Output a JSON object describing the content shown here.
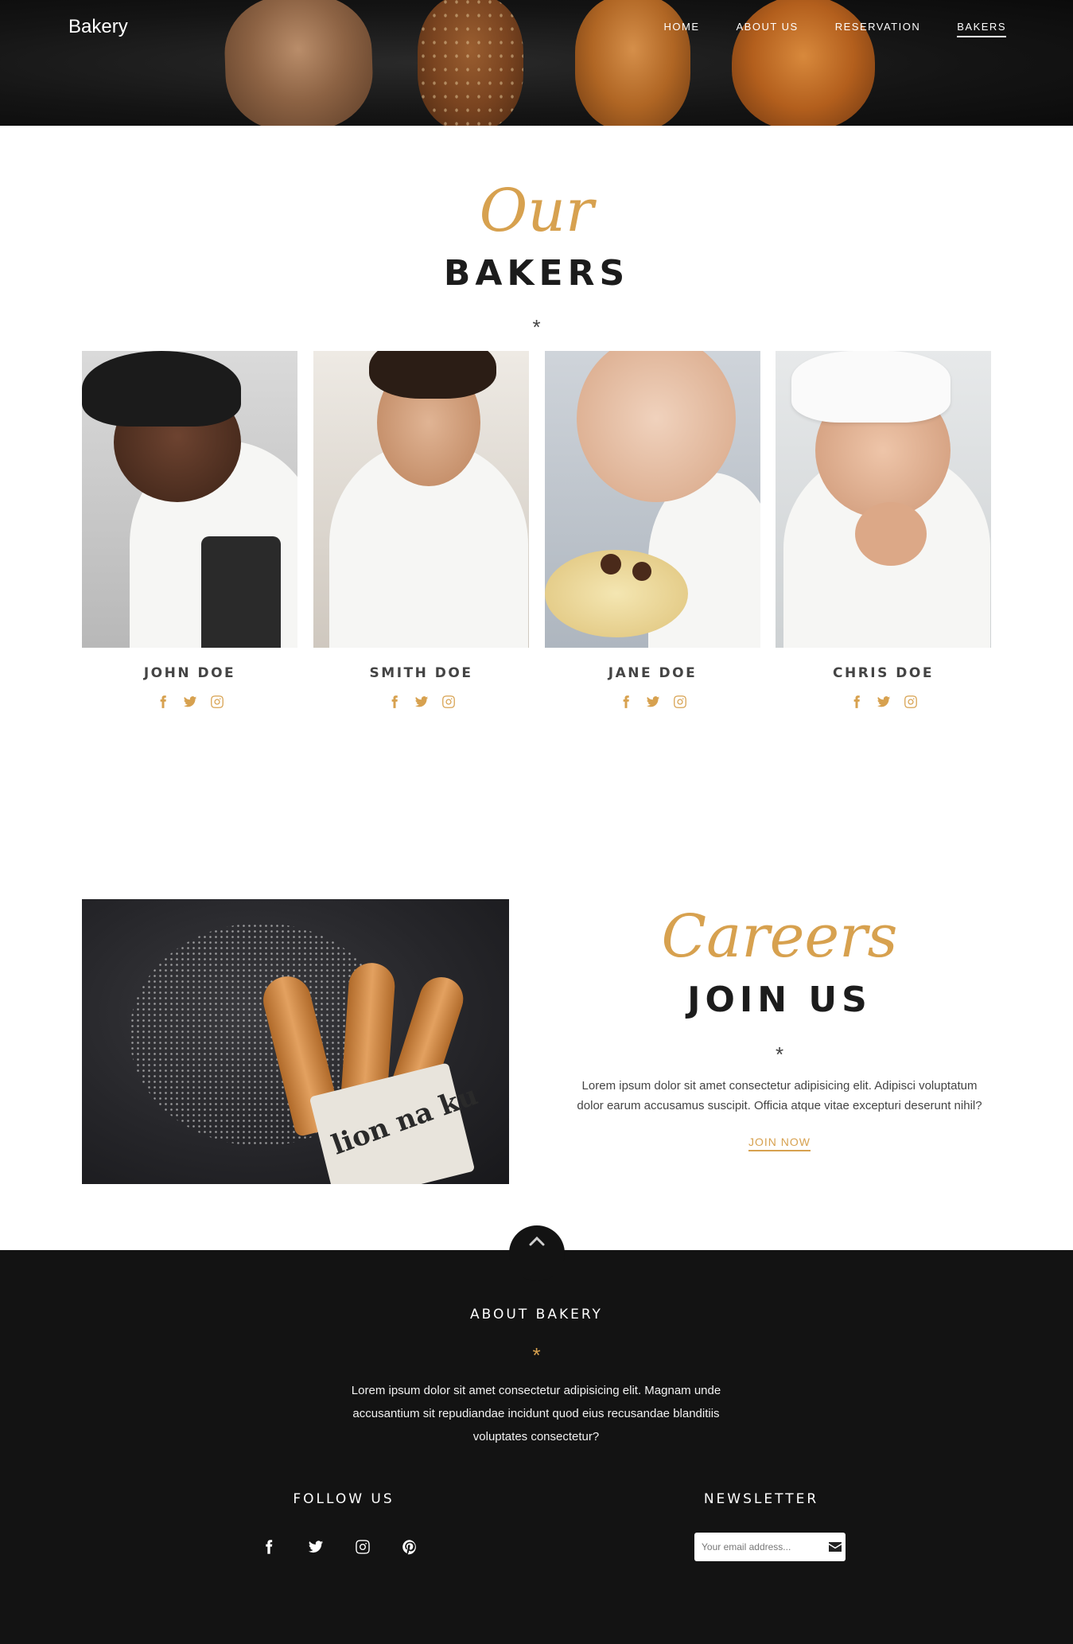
{
  "nav": {
    "brand": "Bakery",
    "items": [
      {
        "label": "HOME"
      },
      {
        "label": "ABOUT US"
      },
      {
        "label": "RESERVATION"
      },
      {
        "label": "BAKERS",
        "active": true
      }
    ]
  },
  "bakers": {
    "script_title": "Our",
    "title": "BAKERS",
    "divider": "*",
    "members": [
      {
        "name": "JOHN DOE",
        "socials": [
          "facebook-icon",
          "twitter-icon",
          "instagram-icon"
        ]
      },
      {
        "name": "SMITH DOE",
        "socials": [
          "facebook-icon",
          "twitter-icon",
          "instagram-icon"
        ]
      },
      {
        "name": "JANE DOE",
        "socials": [
          "facebook-icon",
          "twitter-icon",
          "instagram-icon"
        ]
      },
      {
        "name": "CHRIS DOE",
        "socials": [
          "facebook-icon",
          "twitter-icon",
          "instagram-icon"
        ]
      }
    ]
  },
  "careers": {
    "script_title": "Careers",
    "title": "JOIN US",
    "divider": "*",
    "text": "Lorem ipsum dolor sit amet consectetur adipisicing elit. Adipisci voluptatum dolor earum accusamus suscipit. Officia atque vitae excepturi deserunt nihil?",
    "link_label": "JOIN NOW",
    "image_text": "lion na ku"
  },
  "footer": {
    "about_title": "ABOUT BAKERY",
    "about_divider": "*",
    "about_text": "Lorem ipsum dolor sit amet consectetur adipisicing elit. Magnam unde accusantium sit repudiandae incidunt quod eius recusandae blanditiis voluptates consectetur?",
    "follow_title": "FOLLOW US",
    "follow_icons": [
      "facebook-icon",
      "twitter-icon",
      "instagram-icon",
      "pinterest-icon"
    ],
    "newsletter_title": "NEWSLETTER",
    "newsletter_placeholder": "Your email address...",
    "newsletter_button_icon": "envelope-icon"
  },
  "colors": {
    "accent": "#d7a14f",
    "footer_bg": "#131313",
    "heading": "#1c1c1c"
  }
}
